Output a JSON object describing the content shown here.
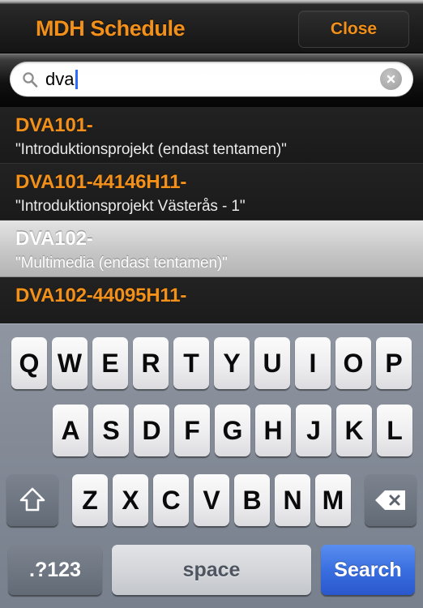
{
  "navbar": {
    "title": "MDH Schedule",
    "close_label": "Close",
    "title_color": "#f39019"
  },
  "search": {
    "value": "dva",
    "placeholder": "Search",
    "search_icon": "search-icon",
    "clear_icon": "clear-circle-icon"
  },
  "results": [
    {
      "code": "DVA101-",
      "name": "\"Introduktionsprojekt (endast tentamen)\"",
      "selected": false
    },
    {
      "code": "DVA101-44146H11-",
      "name": "\"Introduktionsprojekt Västerås - 1\"",
      "selected": false
    },
    {
      "code": "DVA102-",
      "name": "\"Multimedia (endast tentamen)\"",
      "selected": true
    },
    {
      "code": "DVA102-44095H11-",
      "name": "",
      "selected": false
    }
  ],
  "keyboard": {
    "row1": [
      "Q",
      "W",
      "E",
      "R",
      "T",
      "Y",
      "U",
      "I",
      "O",
      "P"
    ],
    "row2": [
      "A",
      "S",
      "D",
      "F",
      "G",
      "H",
      "J",
      "K",
      "L"
    ],
    "row3": [
      "Z",
      "X",
      "C",
      "V",
      "B",
      "N",
      "M"
    ],
    "shift_icon": "shift-arrow-icon",
    "backspace_icon": "backspace-icon",
    "numbers_label": ".?123",
    "space_label": "space",
    "search_label": "Search",
    "search_key_color": "#3a6fe0"
  }
}
